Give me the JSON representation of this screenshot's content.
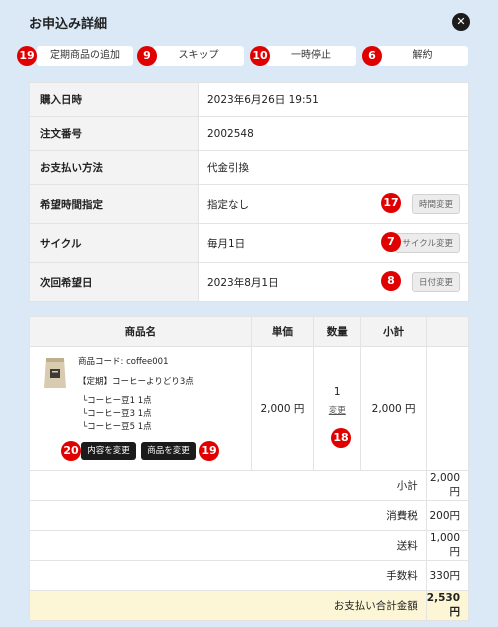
{
  "modal": {
    "title": "お申込み詳細",
    "close_glyph": "✕"
  },
  "actions": [
    {
      "badge": "19",
      "label": "定期商品の追加"
    },
    {
      "badge": "9",
      "label": "スキップ"
    },
    {
      "badge": "10",
      "label": "一時停止"
    },
    {
      "badge": "6",
      "label": "解約"
    }
  ],
  "info": {
    "purchase_date": {
      "label": "購入日時",
      "value": "2023年6月26日 19:51"
    },
    "order_number": {
      "label": "注文番号",
      "value": "2002548"
    },
    "payment": {
      "label": "お支払い方法",
      "value": "代金引換"
    },
    "time": {
      "label": "希望時間指定",
      "value": "指定なし",
      "button": "時間変更",
      "badge": "17"
    },
    "cycle": {
      "label": "サイクル",
      "value": "毎月1日",
      "button": "サイクル変更",
      "badge": "7"
    },
    "next_date": {
      "label": "次回希望日",
      "value": "2023年8月1日",
      "button": "日付変更",
      "badge": "8"
    }
  },
  "products": {
    "headers": {
      "name": "商品名",
      "unit_price": "単価",
      "qty": "数量",
      "subtotal": "小計"
    },
    "item": {
      "code": "商品コード: coffee001",
      "name": "【定期】コーヒーよりどり3点",
      "options": [
        "└コーヒー豆1 1点",
        "└コーヒー豆3 1点",
        "└コーヒー豆5 1点"
      ],
      "unit_price": "2,000 円",
      "qty": "1",
      "qty_change": "変更",
      "qty_badge": "18",
      "subtotal": "2,000 円",
      "content_button": "内容を変更",
      "content_badge": "20",
      "product_button": "商品を変更",
      "product_badge": "19"
    }
  },
  "summary": [
    {
      "label": "小計",
      "value": "2,000 円"
    },
    {
      "label": "消費税",
      "value": "200円"
    },
    {
      "label": "送料",
      "value": "1,000円"
    },
    {
      "label": "手数料",
      "value": "330円"
    }
  ],
  "total": {
    "label": "お支払い合計金額",
    "value": "2,530 円"
  },
  "colors": {
    "background": "#dbe9f6",
    "badge": "#e10000",
    "total_row": "#fdf6d6"
  }
}
